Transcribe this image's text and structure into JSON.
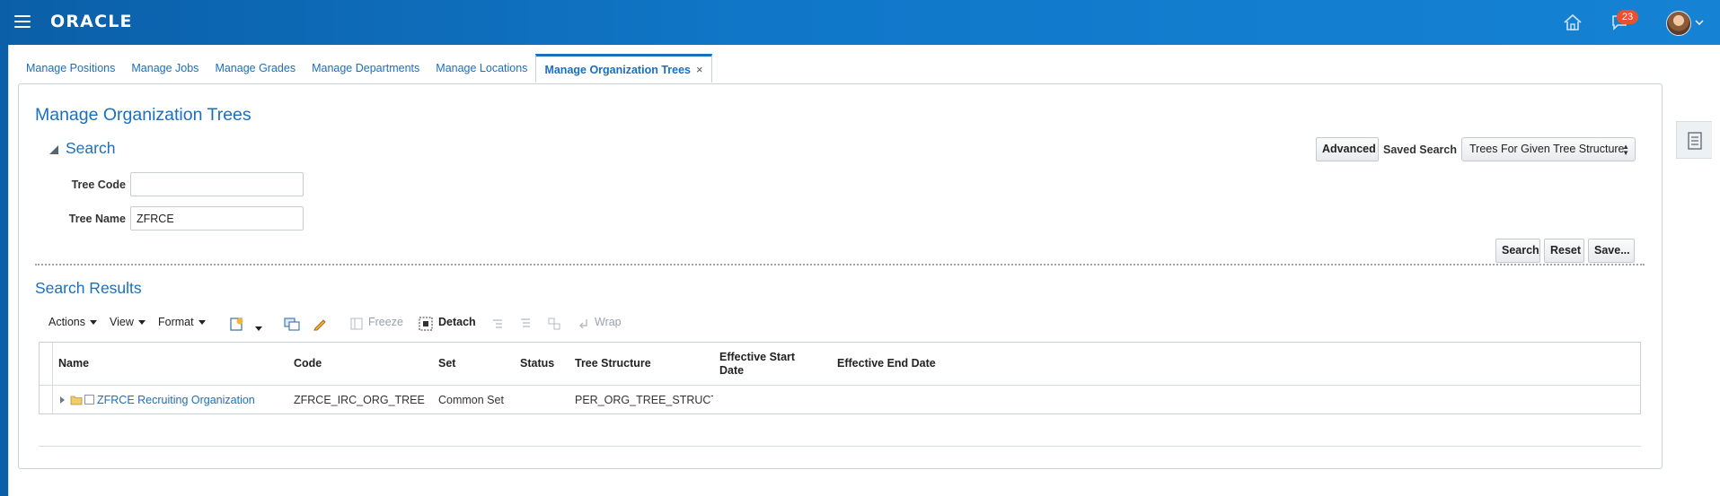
{
  "header": {
    "logo": "ORACLE",
    "notification_count": "23"
  },
  "tabs": [
    {
      "label": "Manage Positions"
    },
    {
      "label": "Manage Jobs"
    },
    {
      "label": "Manage Grades"
    },
    {
      "label": "Manage Departments"
    },
    {
      "label": "Manage Locations"
    },
    {
      "label": "Manage Organization Trees",
      "close": "×"
    }
  ],
  "page": {
    "title": "Manage Organization Trees"
  },
  "search": {
    "heading": "Search",
    "advanced_label": "Advanced",
    "saved_search_label": "Saved Search",
    "saved_search_value": "Trees For Given Tree Structure",
    "tree_code_label": "Tree Code",
    "tree_code_value": "",
    "tree_name_label": "Tree Name",
    "tree_name_value": "ZFRCE",
    "search_button": "Search",
    "reset_button": "Reset",
    "save_button": "Save..."
  },
  "results": {
    "heading": "Search Results",
    "toolbar": {
      "actions": "Actions",
      "view": "View",
      "format": "Format",
      "freeze": "Freeze",
      "detach": "Detach",
      "wrap": "Wrap"
    },
    "columns": [
      "Name",
      "Code",
      "Set",
      "Status",
      "Tree Structure",
      "Effective Start Date",
      "Effective End Date"
    ],
    "rows": [
      {
        "name": "ZFRCE Recruiting Organization",
        "code": "ZFRCE_IRC_ORG_TREE",
        "set": "Common Set",
        "status": "",
        "tree_structure": "PER_ORG_TREE_STRUCTURE",
        "effective_start_date": "",
        "effective_end_date": ""
      }
    ]
  },
  "colors": {
    "header_blue": "#0b5fa8",
    "link_blue": "#1a6fbf",
    "badge": "#e8522e"
  },
  "icons": [
    "hamburger-icon",
    "home-icon",
    "notifications-icon",
    "user-avatar",
    "chevron-down-icon",
    "side-panel-icon",
    "collapse-triangle-icon",
    "create-icon",
    "query-by-example-icon",
    "edit-icon",
    "freeze-icon",
    "detach-icon",
    "expand-node-icon",
    "folder-icon",
    "checkbox-icon"
  ]
}
